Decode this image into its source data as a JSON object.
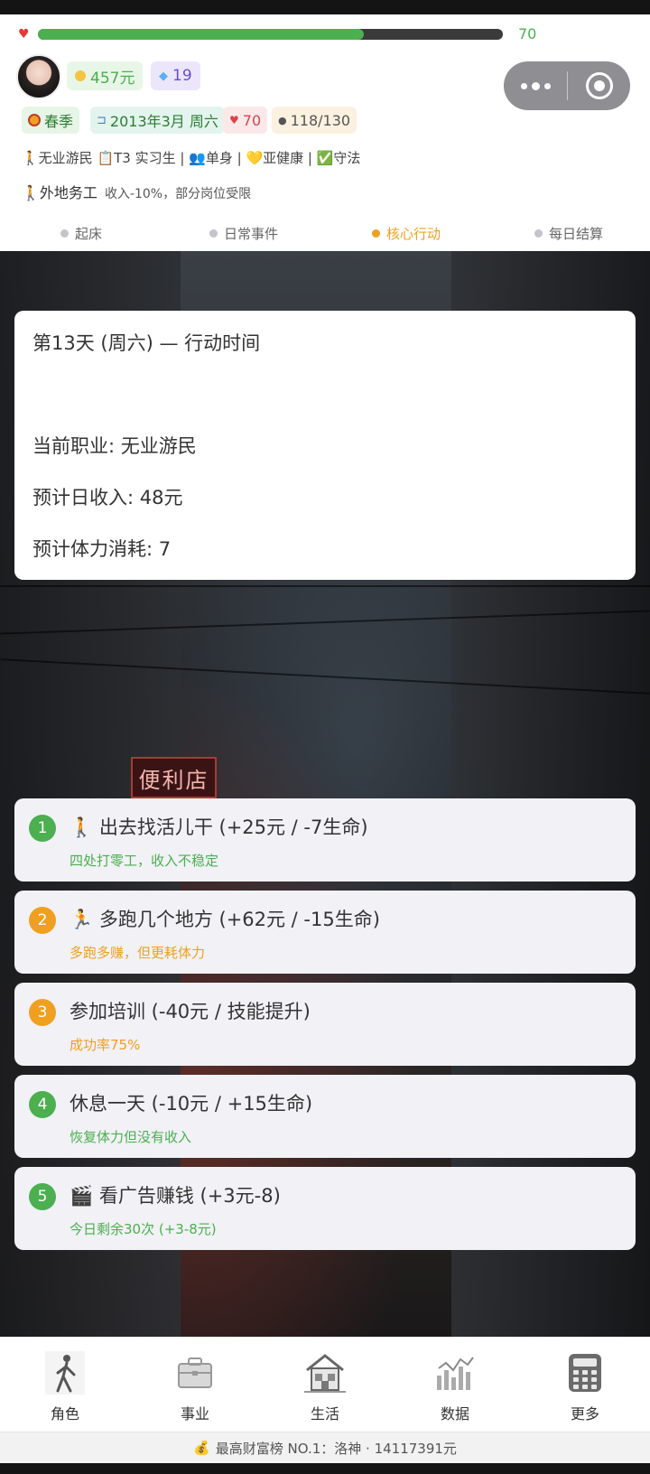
{
  "status": {
    "hp_value": "70",
    "hp_fraction": 0.7,
    "money": "457元",
    "gems": "19"
  },
  "tags": {
    "season": "春季",
    "date": "2013年3月 周六",
    "hp": "70",
    "energy": "118/130"
  },
  "status_line": "🚶无业游民 📋T3 实习生 | 👥单身 | 💛亚健康 | ✅守法",
  "migrant": {
    "title": "🚶外地务工",
    "note": "收入-10%，部分岗位受限"
  },
  "steps": [
    {
      "label": "起床",
      "active": false
    },
    {
      "label": "日常事件",
      "active": false
    },
    {
      "label": "核心行动",
      "active": true
    },
    {
      "label": "每日结算",
      "active": false
    }
  ],
  "info": {
    "title": "第13天 (周六) — 行动时间",
    "job": "当前职业: 无业游民",
    "income": "预计日收入: 48元",
    "stamina": "预计体力消耗: 7"
  },
  "scene": {
    "shop_sign": "便利店"
  },
  "actions": [
    {
      "num": "1",
      "label": "🚶 出去找活儿干 (+25元 / -7生命)",
      "desc": "四处打零工，收入不稳定",
      "color": "#4caf50"
    },
    {
      "num": "2",
      "label": "🏃 多跑几个地方 (+62元 / -15生命)",
      "desc": "多跑多赚，但更耗体力",
      "color": "#f0a020"
    },
    {
      "num": "3",
      "label": "参加培训 (-40元 / 技能提升)",
      "desc": "成功率75%",
      "color": "#f0a020"
    },
    {
      "num": "4",
      "label": "休息一天 (-10元 / +15生命)",
      "desc": "恢复体力但没有收入",
      "color": "#4caf50"
    },
    {
      "num": "5",
      "label": "🎬 看广告赚钱 (+3元-8)",
      "desc": "今日剩余30次 (+3-8元)",
      "color": "#4caf50"
    }
  ],
  "nav": [
    {
      "label": "角色",
      "icon": "walking-person-icon"
    },
    {
      "label": "事业",
      "icon": "briefcase-icon"
    },
    {
      "label": "生活",
      "icon": "house-icon"
    },
    {
      "label": "数据",
      "icon": "bar-chart-icon"
    },
    {
      "label": "更多",
      "icon": "calculator-icon"
    }
  ],
  "footer": "最高财富榜 NO.1：洛神 · 14117391元"
}
